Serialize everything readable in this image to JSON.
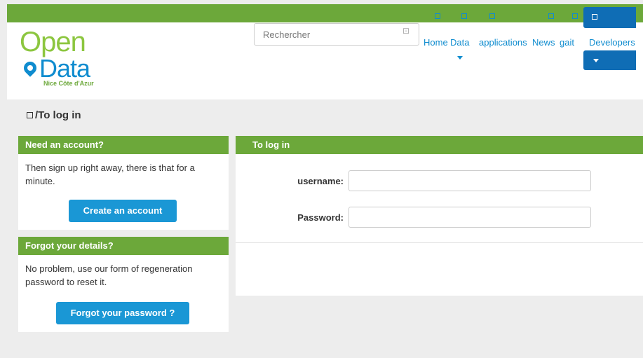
{
  "header": {
    "logo": {
      "line1": "Open",
      "line2": "Data",
      "tagline": "Nice Côte d'Azur"
    },
    "search": {
      "placeholder": "Rechercher",
      "icon": "search-icon"
    },
    "nav": [
      {
        "label": "Home",
        "icon": "square-icon"
      },
      {
        "label": "Data",
        "icon": "square-icon",
        "has_dropdown": true
      },
      {
        "label": "applications",
        "icon": "square-icon"
      },
      {
        "label": "News",
        "icon": "square-icon"
      },
      {
        "label": "gait",
        "icon": "square-icon"
      },
      {
        "label": "Developers",
        "icon": "square-icon",
        "has_dropdown": true
      }
    ]
  },
  "breadcrumb": {
    "text": "/To log in",
    "icon": "square-icon"
  },
  "account_panel": {
    "title": "Need an account?",
    "text": "Then sign up right away, there is that for a minute.",
    "button_label": "Create an account"
  },
  "forgot_panel": {
    "title": "Forgot your details?",
    "text": "No problem, use our form of regeneration password to reset it.",
    "button_label": "Forgot your password ?"
  },
  "login_panel": {
    "title": "To log in",
    "username_label": "username:",
    "password_label": "Password:",
    "username_value": "",
    "password_value": ""
  },
  "colors": {
    "green": "#6ca83a",
    "blue": "#1a97d5",
    "dark_blue": "#0f6db5",
    "background": "#ededed"
  }
}
